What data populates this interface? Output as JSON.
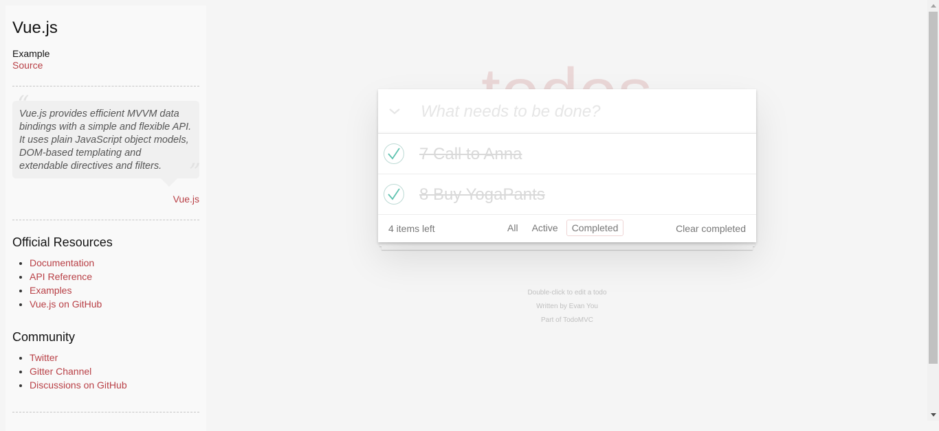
{
  "sidebar": {
    "app_name": "Vue.js",
    "example_label": "Example",
    "source_link": "Source",
    "quote": "Vue.js provides efficient MVVM data bindings with a simple and flexible API. It uses plain JavaScript object models, DOM-based templating and extendable directives and filters.",
    "quote_open": "“",
    "quote_close": "”",
    "quote_author": "Vue.js",
    "official_title": "Official Resources",
    "official_links": [
      "Documentation",
      "API Reference",
      "Examples",
      "Vue.js on GitHub"
    ],
    "community_title": "Community",
    "community_links": [
      "Twitter",
      "Gitter Channel",
      "Discussions on GitHub"
    ]
  },
  "app": {
    "title": "todos",
    "new_todo_placeholder": "What needs to be done?",
    "new_todo_value": "",
    "toggle_all_icon": "chevron-down-icon",
    "todos": [
      {
        "label": "7 Call to Anna",
        "completed": true
      },
      {
        "label": "8 Buy YogaPants",
        "completed": true
      }
    ],
    "footer": {
      "count": "4 items left",
      "filters": [
        "All",
        "Active",
        "Completed"
      ],
      "selected_filter": "Completed",
      "clear_completed": "Clear completed"
    }
  },
  "info": {
    "line1": "Double-click to edit a todo",
    "line2": "Written by Evan You",
    "line3": "Part of TodoMVC"
  },
  "colors": {
    "accent": "#b83f45",
    "title": "#ead7d7",
    "check": "#5dc2af",
    "background": "#f5f5f5"
  }
}
